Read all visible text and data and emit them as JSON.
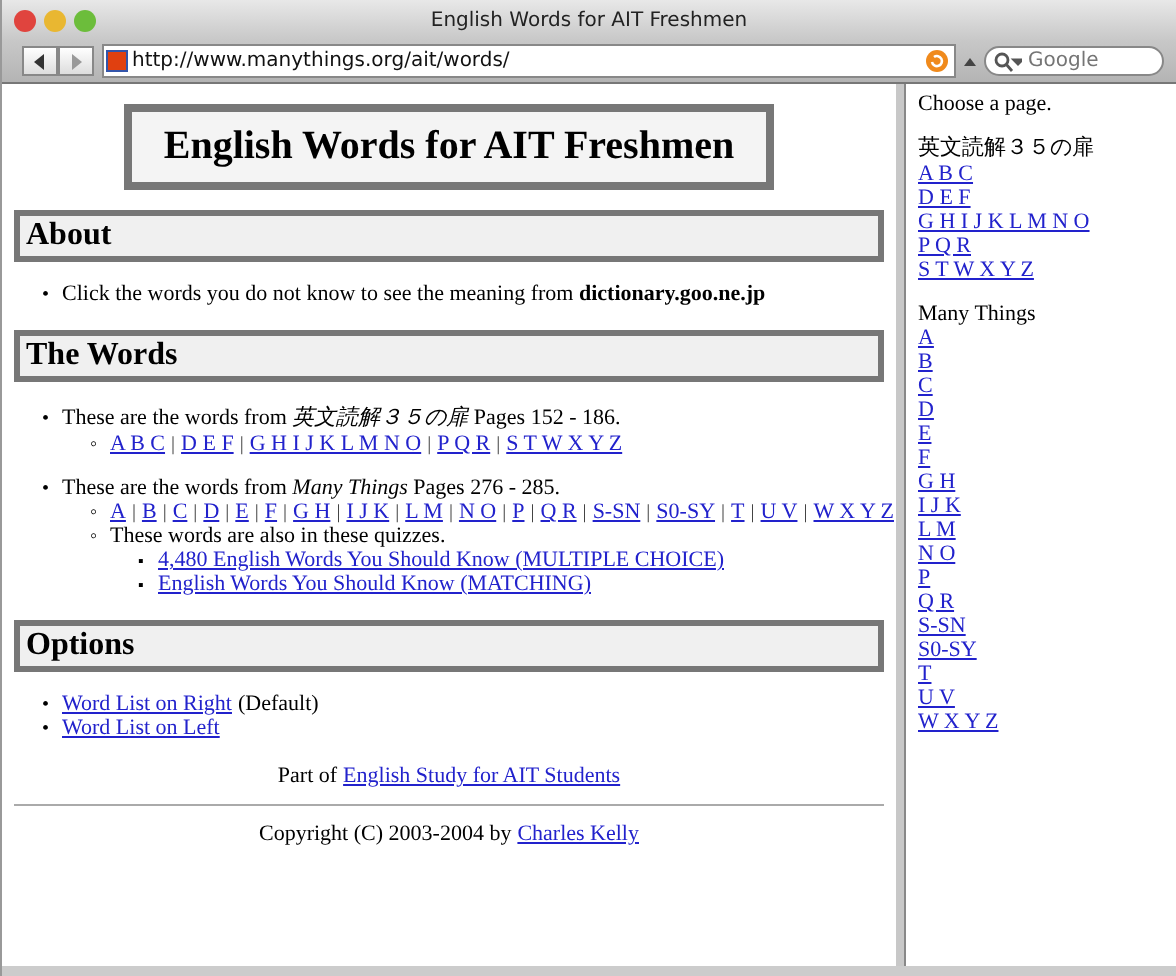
{
  "window": {
    "title": "English Words for AIT Freshmen"
  },
  "markers": {
    "bullet": "•",
    "circle": "◦",
    "square": "▪",
    "separator": "|"
  },
  "toolbar": {
    "url": "http://www.manythings.org/ait/words/",
    "search_placeholder": "Google"
  },
  "main": {
    "title": "English Words for AIT Freshmen",
    "about": {
      "heading": "About",
      "text": "Click the words you do not know to see the meaning from **dictionary.goo.ne.jp**"
    },
    "words": {
      "heading": "The Words",
      "items": [
        {
          "before": "These are the words from ",
          "source": "英文読解３５の扉",
          "after": " Pages 152 - 186.",
          "links": [
            "A B C",
            "D E F",
            "G H I J K L M N O",
            "P Q R",
            "S T W X Y Z"
          ]
        },
        {
          "before": "These are the words from ",
          "source": "Many Things",
          "after": " Pages 276 - 285.",
          "links": [
            "A",
            "B",
            "C",
            "D",
            "E",
            "F",
            "G H",
            "I J K",
            "L M",
            "N O",
            "P",
            "Q R",
            "S-SN",
            "S0-SY",
            "T",
            "U V",
            "W X Y Z"
          ],
          "note": "These words are also in these quizzes.",
          "quizzes": [
            "4,480 English Words You Should Know (MULTIPLE CHOICE)",
            "English Words You Should Know (MATCHING)"
          ]
        }
      ]
    },
    "options": {
      "heading": "Options",
      "items": [
        {
          "link": "Word List on Right",
          "note": "(Default)"
        },
        {
          "link": "Word List on Left"
        }
      ]
    },
    "part_of": {
      "text": "Part of",
      "link": "English Study for AIT Students"
    },
    "copyright": {
      "text": "Copyright (C) 2003-2004 by",
      "link": "Charles Kelly"
    }
  },
  "sidebar": {
    "prompt": "Choose a page.",
    "groups": [
      {
        "title": "英文読解３５の扉",
        "links": [
          "A B C",
          "D E F",
          "G H I J K L M N O",
          "P Q R",
          "S T W X Y Z"
        ]
      },
      {
        "title": "Many Things",
        "links": [
          "A",
          "B",
          "C",
          "D",
          "E",
          "F",
          "G H",
          "I J K",
          "L M",
          "N O",
          "P",
          "Q R",
          "S-SN",
          "S0-SY",
          "T",
          "U V",
          "W X Y Z"
        ]
      }
    ]
  }
}
